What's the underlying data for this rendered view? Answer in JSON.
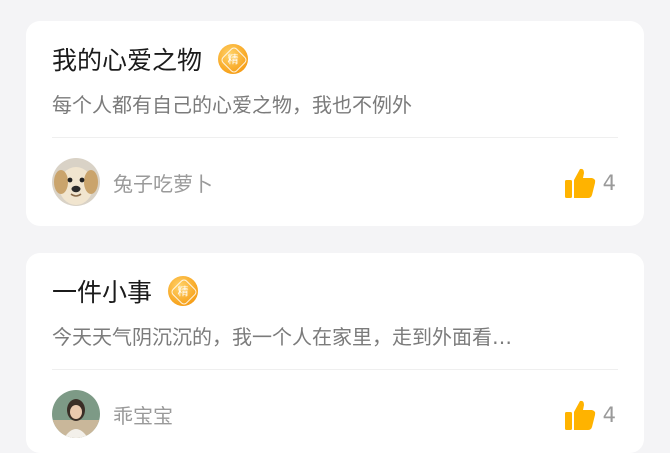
{
  "posts": [
    {
      "title": "我的心爱之物",
      "badge": "精",
      "badge_icon": "featured-badge-icon",
      "excerpt": "每个人都有自己的心爱之物，我也不例外",
      "author": "兔子吃萝卜",
      "avatar_icon": "puppy-avatar",
      "likes": "4",
      "like_icon": "thumbs-up-icon"
    },
    {
      "title": "一件小事",
      "badge": "精",
      "badge_icon": "featured-badge-icon",
      "excerpt": "今天天气阴沉沉的，我一个人在家里，走到外面看…",
      "author": "乖宝宝",
      "avatar_icon": "girl-avatar",
      "likes": "4",
      "like_icon": "thumbs-up-icon"
    }
  ],
  "colors": {
    "background": "#f4f4f6",
    "card": "#ffffff",
    "title": "#1b1b1b",
    "excerpt": "#7b7b7b",
    "meta": "#9a9a9a",
    "accent": "#ffb300"
  }
}
